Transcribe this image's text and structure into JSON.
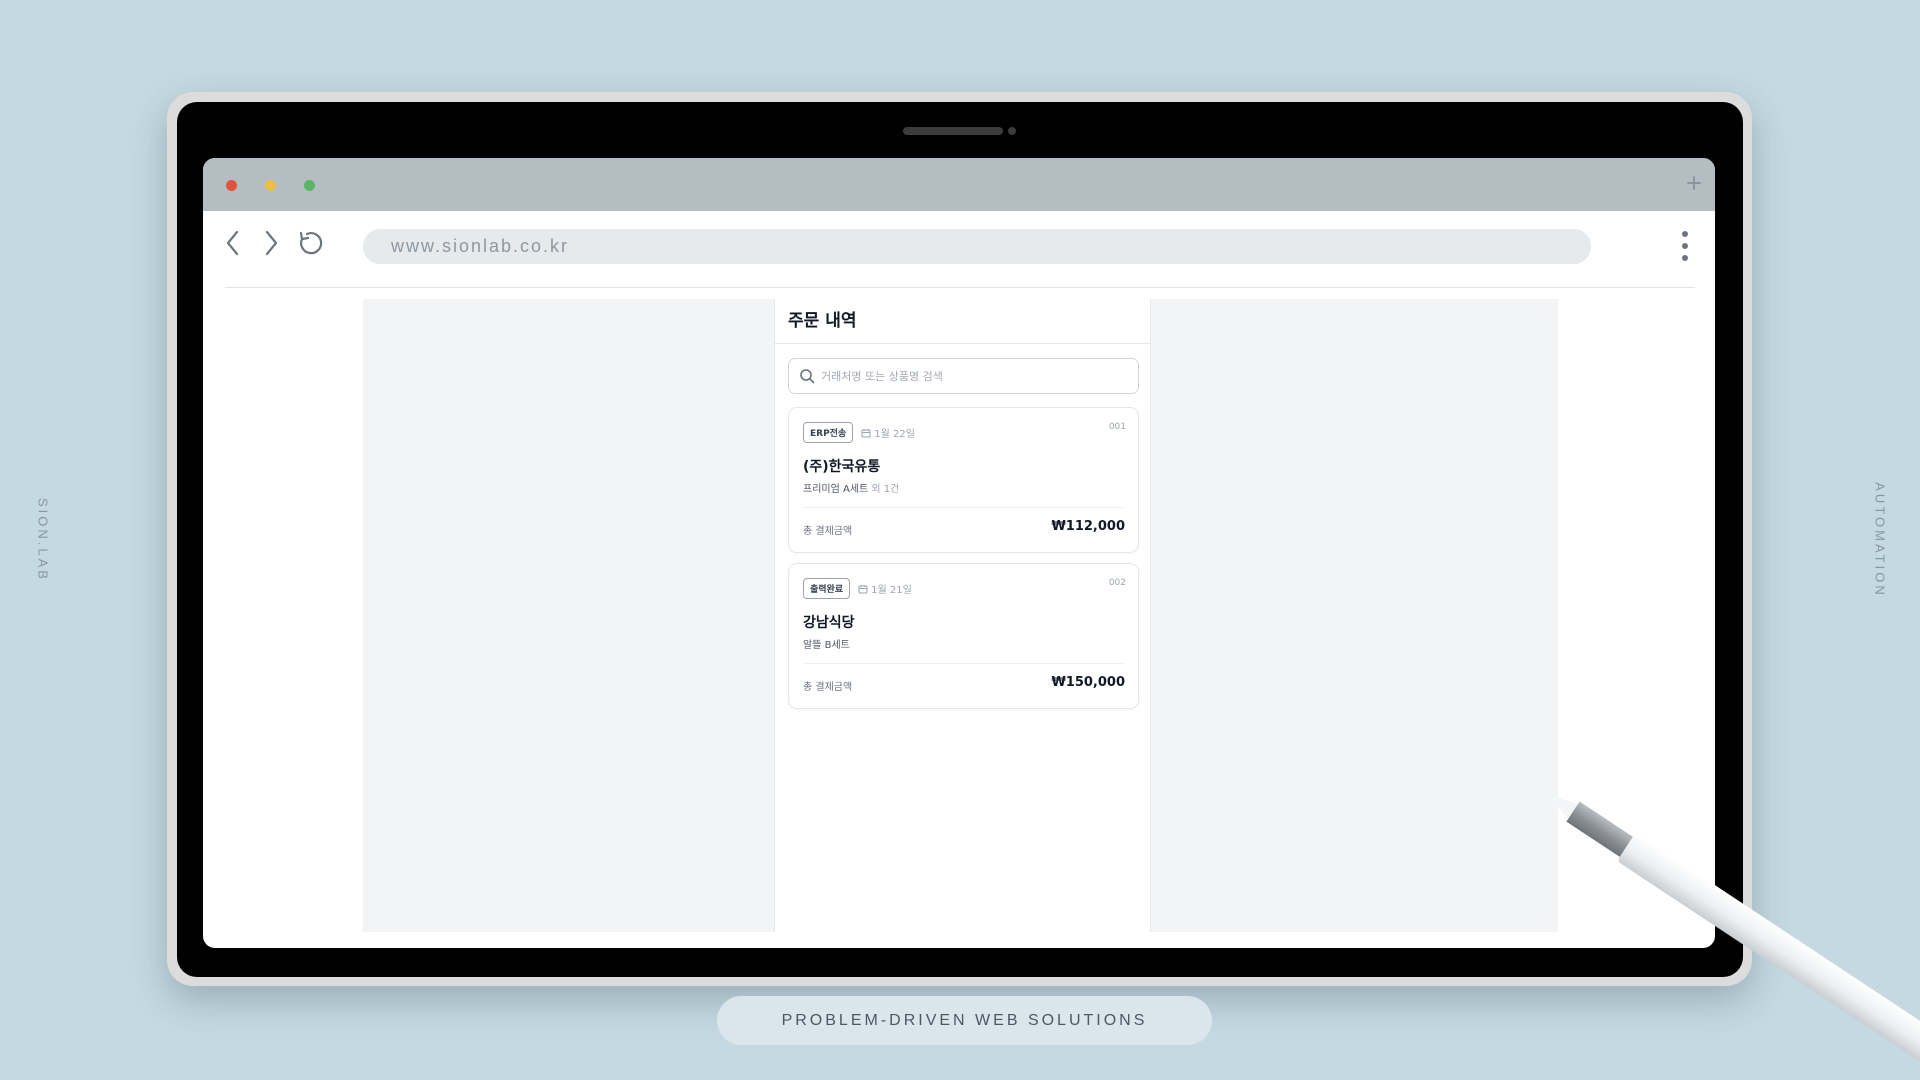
{
  "side_labels": {
    "left": "SION.LAB",
    "right": "AUTOMATION"
  },
  "browser": {
    "url": "www.sionlab.co.kr",
    "traffic_colors": {
      "close": "#e0543e",
      "minimize": "#edbe45",
      "maximize": "#5cb465"
    }
  },
  "app": {
    "title": "주문 내역",
    "search": {
      "placeholder": "거래처명 또는 상품명 검색",
      "value": ""
    },
    "orders": [
      {
        "status": "ERP전송",
        "date": "1월 22일",
        "number": "001",
        "customer": "(주)한국유통",
        "product": "프리미엄 A세트",
        "product_extra": "외 1건",
        "total_label": "총 결제금액",
        "total": "₩112,000"
      },
      {
        "status": "출력완료",
        "date": "1월 21일",
        "number": "002",
        "customer": "강남식당",
        "product": "알뜰 B세트",
        "product_extra": "",
        "total_label": "총 결제금액",
        "total": "₩150,000"
      }
    ]
  },
  "footer": {
    "tagline": "PROBLEM-DRIVEN WEB SOLUTIONS"
  }
}
